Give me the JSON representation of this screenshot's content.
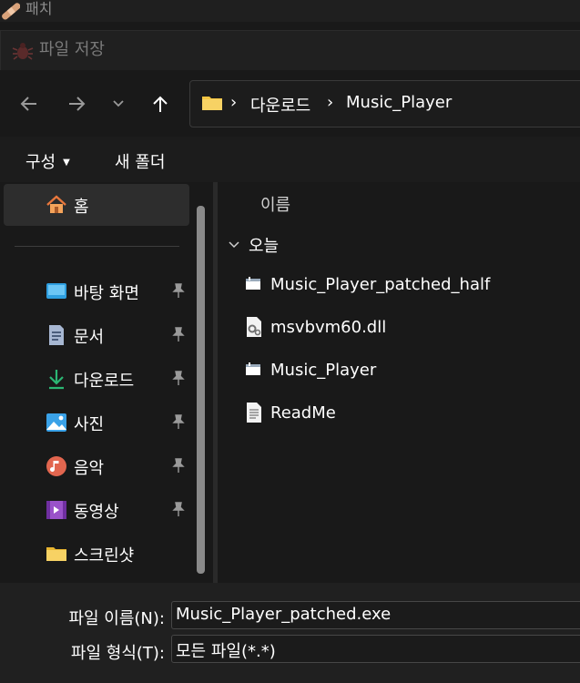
{
  "outer_window": {
    "title": "패치"
  },
  "dialog": {
    "title": "파일 저장"
  },
  "address_bar": {
    "breadcrumbs": [
      "다운로드",
      "Music_Player"
    ],
    "separator": "›"
  },
  "toolbar": {
    "organize_label": "구성",
    "new_folder_label": "새 폴더"
  },
  "sidebar": {
    "home_label": "홈",
    "items": [
      {
        "label": "바탕 화면",
        "icon": "desktop-icon",
        "pinned": true
      },
      {
        "label": "문서",
        "icon": "document-icon",
        "pinned": true
      },
      {
        "label": "다운로드",
        "icon": "download-icon",
        "pinned": true
      },
      {
        "label": "사진",
        "icon": "pictures-icon",
        "pinned": true
      },
      {
        "label": "음악",
        "icon": "music-icon",
        "pinned": true
      },
      {
        "label": "동영상",
        "icon": "video-icon",
        "pinned": true
      },
      {
        "label": "스크린샷",
        "icon": "folder-icon",
        "pinned": false
      }
    ]
  },
  "file_list": {
    "column_header": "이름",
    "group_label": "오늘",
    "files": [
      {
        "name": "Music_Player_patched_half",
        "icon": "exe-icon"
      },
      {
        "name": "msvbvm60.dll",
        "icon": "dll-icon"
      },
      {
        "name": "Music_Player",
        "icon": "exe-icon"
      },
      {
        "name": "ReadMe",
        "icon": "text-file-icon"
      }
    ]
  },
  "form": {
    "filename_label": "파일 이름(N):",
    "filename_value": "Music_Player_patched.exe",
    "filetype_label": "파일 형식(T):",
    "filetype_value": "모든 파일(*.*)"
  },
  "colors": {
    "background": "#191919",
    "accent_folder": "#f4c542",
    "download_green": "#2bb673"
  }
}
